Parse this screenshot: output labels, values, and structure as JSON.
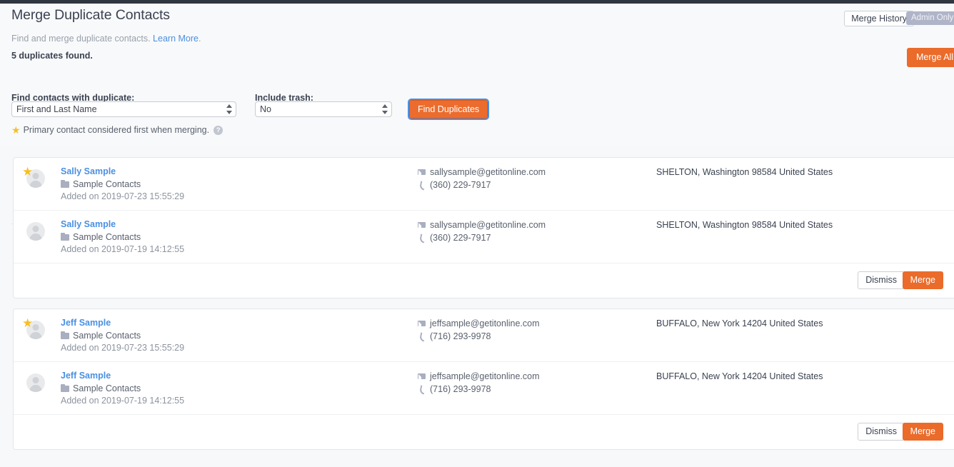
{
  "header": {
    "title": "Merge Duplicate Contacts",
    "subtitle_text": "Find and merge duplicate contacts.",
    "learn_more_label": "Learn More",
    "subtitle_suffix": ".",
    "duplicates_found": "5 duplicates found.",
    "merge_history_label": "Merge History",
    "admin_badge_label": "Admin Only",
    "merge_all_label": "Merge All"
  },
  "filters": {
    "find_label": "Find contacts with duplicate:",
    "find_value": "First and Last Name",
    "trash_label": "Include trash:",
    "trash_value": "No",
    "find_duplicates_label": "Find Duplicates",
    "primary_note": "Primary contact considered first when merging.",
    "help_glyph": "?",
    "star_glyph": "★"
  },
  "actions": {
    "dismiss_label": "Dismiss",
    "merge_label": "Merge"
  },
  "cards": [
    {
      "contacts": [
        {
          "name": "Sally Sample",
          "primary": true,
          "star_glyph": "★",
          "group": "Sample Contacts",
          "added": "Added on 2019-07-23 15:55:29",
          "email": "sallysample@getitonline.com",
          "phone": "(360) 229-7917",
          "address": "SHELTON, Washington 98584 United States"
        },
        {
          "name": "Sally Sample",
          "primary": false,
          "star_glyph": "",
          "group": "Sample Contacts",
          "added": "Added on 2019-07-19 14:12:55",
          "email": "sallysample@getitonline.com",
          "phone": "(360) 229-7917",
          "address": "SHELTON, Washington 98584 United States"
        }
      ]
    },
    {
      "contacts": [
        {
          "name": "Jeff Sample",
          "primary": true,
          "star_glyph": "★",
          "group": "Sample Contacts",
          "added": "Added on 2019-07-23 15:55:29",
          "email": "jeffsample@getitonline.com",
          "phone": "(716) 293-9978",
          "address": "BUFFALO, New York 14204 United States"
        },
        {
          "name": "Jeff Sample",
          "primary": false,
          "star_glyph": "",
          "group": "Sample Contacts",
          "added": "Added on 2019-07-19 14:12:55",
          "email": "jeffsample@getitonline.com",
          "phone": "(716) 293-9978",
          "address": "BUFFALO, New York 14204 United States"
        }
      ]
    }
  ],
  "colors": {
    "accent_orange": "#ea6b2a",
    "link_blue": "#4a90e2",
    "star_yellow": "#f5c025",
    "badge_grey": "#b0b4c8",
    "page_bg": "#f7f8f9"
  }
}
